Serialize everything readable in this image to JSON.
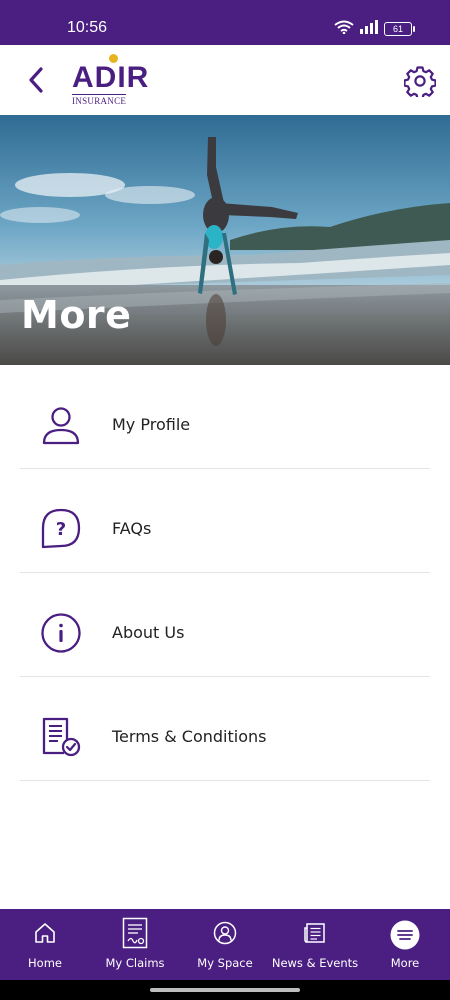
{
  "status_bar": {
    "time": "10:56",
    "battery": "61"
  },
  "header": {
    "logo_text": "ADIR",
    "logo_subtext": "INSURANCE",
    "back_icon": "chevron-left-icon",
    "settings_icon": "gear-icon"
  },
  "hero": {
    "title": "More"
  },
  "menu": {
    "items": [
      {
        "label": "My Profile",
        "icon": "user-icon"
      },
      {
        "label": "FAQs",
        "icon": "question-bubble-icon"
      },
      {
        "label": "About Us",
        "icon": "info-icon"
      },
      {
        "label": "Terms & Conditions",
        "icon": "document-check-icon"
      }
    ]
  },
  "bottom_nav": {
    "items": [
      {
        "label": "Home",
        "icon": "home-icon"
      },
      {
        "label": "My Claims",
        "icon": "claims-document-icon"
      },
      {
        "label": "My Space",
        "icon": "profile-circle-icon"
      },
      {
        "label": "News & Events",
        "icon": "newspaper-icon"
      },
      {
        "label": "More",
        "icon": "menu-lines-icon",
        "active": true
      }
    ]
  },
  "colors": {
    "brand_purple": "#4b1e82",
    "logo_gold": "#e8b321"
  }
}
